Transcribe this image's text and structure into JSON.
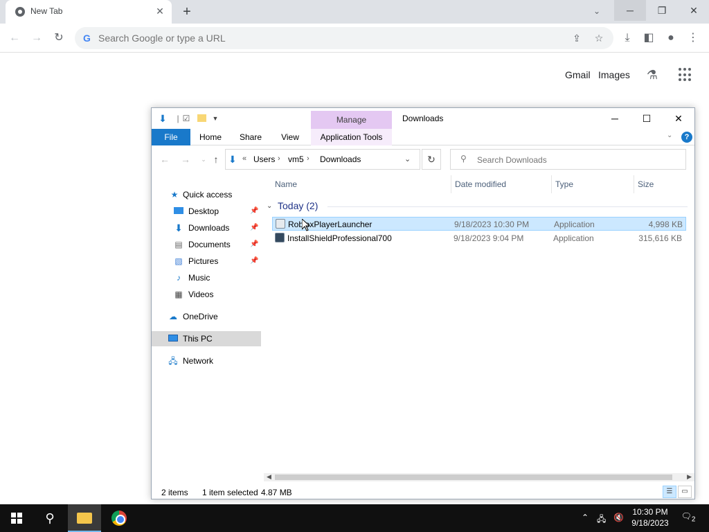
{
  "chrome": {
    "tab_title": "New Tab",
    "tab_close": "✕",
    "new_tab": "+",
    "tab_search": "⌄",
    "win_min": "─",
    "win_max": "❐",
    "win_close": "✕",
    "omnibox_placeholder": "Search Google or type a URL",
    "links": {
      "gmail": "Gmail",
      "images": "Images"
    }
  },
  "explorer": {
    "window_title": "Downloads",
    "manage_label": "Manage",
    "ribbon_tabs": {
      "file": "File",
      "home": "Home",
      "share": "Share",
      "view": "View",
      "app_tools": "Application Tools"
    },
    "breadcrumb": {
      "overflow": "«",
      "items": [
        "Users",
        "vm5",
        "Downloads"
      ]
    },
    "search_placeholder": "Search Downloads",
    "nav_pane": [
      {
        "label": "Quick access",
        "icon": "star-icon"
      },
      {
        "label": "Desktop",
        "icon": "desktop-icon",
        "pinned": true
      },
      {
        "label": "Downloads",
        "icon": "download-icon",
        "pinned": true
      },
      {
        "label": "Documents",
        "icon": "document-icon",
        "pinned": true
      },
      {
        "label": "Pictures",
        "icon": "picture-icon",
        "pinned": true
      },
      {
        "label": "Music",
        "icon": "music-icon"
      },
      {
        "label": "Videos",
        "icon": "video-icon"
      },
      {
        "label": "OneDrive",
        "icon": "cloud-icon"
      },
      {
        "label": "This PC",
        "icon": "computer-icon",
        "selected": true
      },
      {
        "label": "Network",
        "icon": "network-icon"
      }
    ],
    "columns": {
      "name": "Name",
      "date": "Date modified",
      "type": "Type",
      "size": "Size"
    },
    "group_label": "Today (2)",
    "files": [
      {
        "name": "RobloxPlayerLauncher",
        "date": "9/18/2023 10:30 PM",
        "type": "Application",
        "size": "4,998 KB",
        "selected": true
      },
      {
        "name": "InstallShieldProfessional700",
        "date": "9/18/2023 9:04 PM",
        "type": "Application",
        "size": "315,616 KB"
      }
    ],
    "status": {
      "count": "2 items",
      "selected": "1 item selected",
      "size": "4.87 MB"
    }
  },
  "taskbar": {
    "time": "10:30 PM",
    "date": "9/18/2023",
    "notifications": "2"
  }
}
